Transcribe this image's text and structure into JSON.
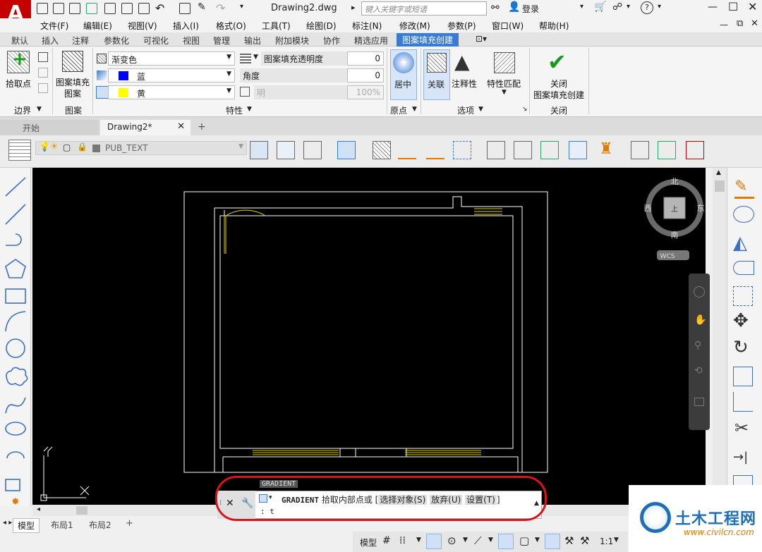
{
  "app": {
    "logo": "A",
    "title": "Drawing2.dwg",
    "search_placeholder": "键入关键字或短语",
    "login": "登录"
  },
  "menu": [
    "文件(F)",
    "编辑(E)",
    "视图(V)",
    "插入(I)",
    "格式(O)",
    "工具(T)",
    "绘图(D)",
    "标注(N)",
    "修改(M)",
    "参数(P)",
    "窗口(W)",
    "帮助(H)"
  ],
  "ribbon_tabs": [
    "默认",
    "插入",
    "注释",
    "参数化",
    "可视化",
    "视图",
    "管理",
    "输出",
    "附加模块",
    "协作",
    "精选应用",
    "图案填充创建"
  ],
  "ribbon_active_tab": "图案填充创建",
  "ribbon": {
    "pick_point": "拾取点",
    "boundary": "边界",
    "hatch_pattern_l1": "图案填充",
    "hatch_pattern_l2": "图案",
    "pattern": "图案",
    "type_value": "渐变色",
    "color1": "蓝",
    "color2": "黄",
    "transparency_label": "图案填充透明度",
    "transparency_value": "0",
    "angle_label": "角度",
    "angle_value": "0",
    "tint_label": "明",
    "tint_value": "100%",
    "properties": "特性",
    "centered": "居中",
    "origin": "原点",
    "associative": "关联",
    "annotative": "注释性",
    "match_props": "特性匹配",
    "options": "选项",
    "close_l1": "关闭",
    "close_l2": "图案填充创建",
    "close": "关闭"
  },
  "colors": {
    "color1": "#0000ff",
    "color2": "#ffff00",
    "accent": "#3a7bd5",
    "highlight": "#d9151b",
    "wall": "#ffffff",
    "door": "#e0d000"
  },
  "doc_tabs": {
    "start": "开始",
    "drawing": "Drawing2*",
    "add": "+"
  },
  "layer": {
    "name": "PUB_TEXT"
  },
  "viewcube": {
    "north": "北",
    "south": "南",
    "east": "东",
    "west": "西",
    "top": "上",
    "wcs": "WCS"
  },
  "ucs": {
    "x": "X",
    "y": "Y"
  },
  "layout_tabs": [
    "模型",
    "布局1",
    "布局2"
  ],
  "status": {
    "model": "模型",
    "scale": "1:1"
  },
  "cmd": {
    "name": "GRADIENT",
    "line1_cmd": "GRADIENT",
    "line1_text": "拾取内部点或",
    "opt1": "选择对象(S)",
    "opt2": "放弃(U)",
    "opt3": "设置(T)",
    "bracket_open": "[",
    "bracket_close": "]",
    "line2": ": t"
  },
  "watermark": {
    "title": "土木工程网",
    "url": "www.civilcn.com"
  }
}
